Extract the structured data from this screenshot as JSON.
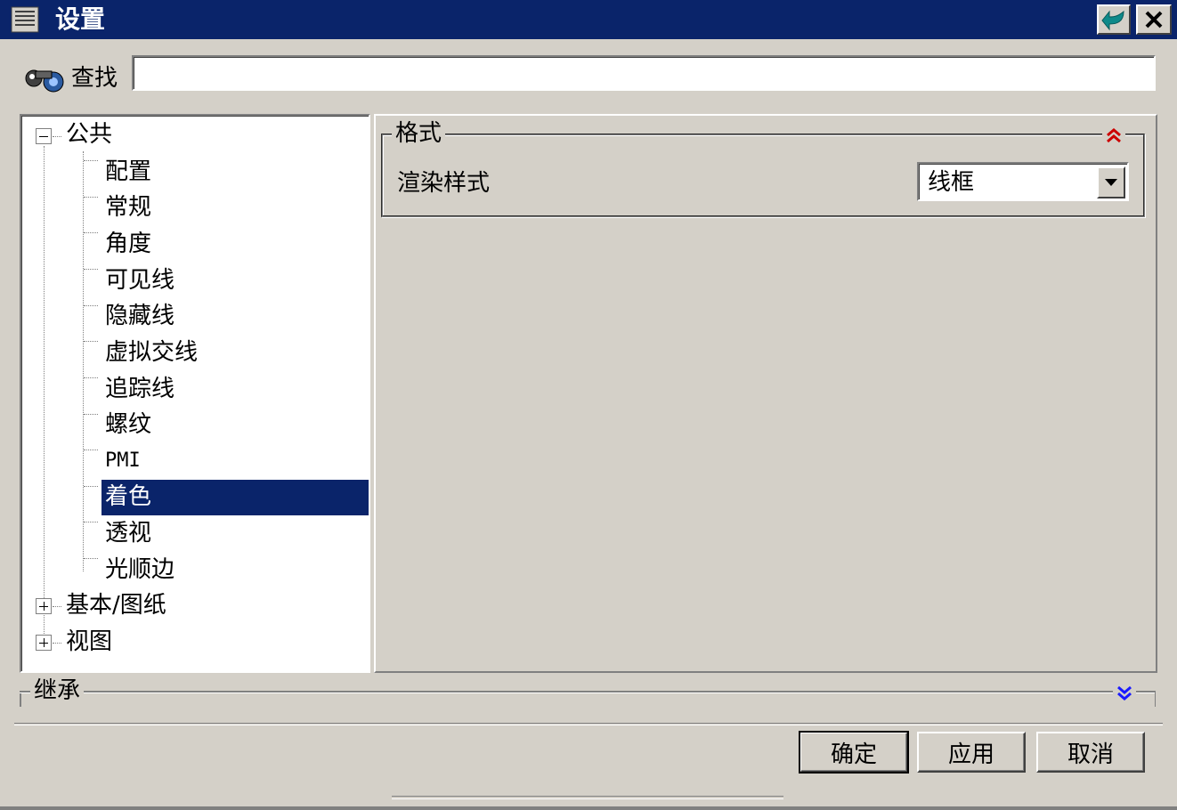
{
  "window": {
    "title": "设置",
    "icons": {
      "menu": "document-menu-icon",
      "back": "back-arrow-icon",
      "close": "close-icon"
    }
  },
  "search": {
    "label": "查找",
    "value": "",
    "placeholder": "",
    "icon": "binoculars-icon"
  },
  "tree": {
    "nodes": [
      {
        "label": "公共",
        "level": 0,
        "expander": "minus"
      },
      {
        "label": "配置",
        "level": 1
      },
      {
        "label": "常规",
        "level": 1
      },
      {
        "label": "角度",
        "level": 1
      },
      {
        "label": "可见线",
        "level": 1
      },
      {
        "label": "隐藏线",
        "level": 1
      },
      {
        "label": "虚拟交线",
        "level": 1
      },
      {
        "label": "追踪线",
        "level": 1
      },
      {
        "label": "螺纹",
        "level": 1
      },
      {
        "label": "PMI",
        "level": 1
      },
      {
        "label": "着色",
        "level": 1,
        "selected": true
      },
      {
        "label": "透视",
        "level": 1
      },
      {
        "label": "光顺边",
        "level": 1
      },
      {
        "label": "基本/图纸",
        "level": 0,
        "expander": "plus"
      },
      {
        "label": "视图",
        "level": 0,
        "expander": "plus"
      }
    ]
  },
  "format_group": {
    "title": "格式",
    "collapse_icon": "double-chevron-up-icon",
    "render_style_label": "渲染样式",
    "render_style_value": "线框",
    "dropdown_icon": "dropdown-arrow-icon"
  },
  "inherit_group": {
    "title": "继承",
    "expand_icon": "double-chevron-down-icon"
  },
  "buttons": {
    "ok": "确定",
    "apply": "应用",
    "cancel": "取消"
  },
  "colors": {
    "titlebar": "#0a246a",
    "selection": "#0a246a",
    "face": "#d4d0c8",
    "collapse_arrow": "#cc0000",
    "expand_arrow": "#1a1aff"
  }
}
